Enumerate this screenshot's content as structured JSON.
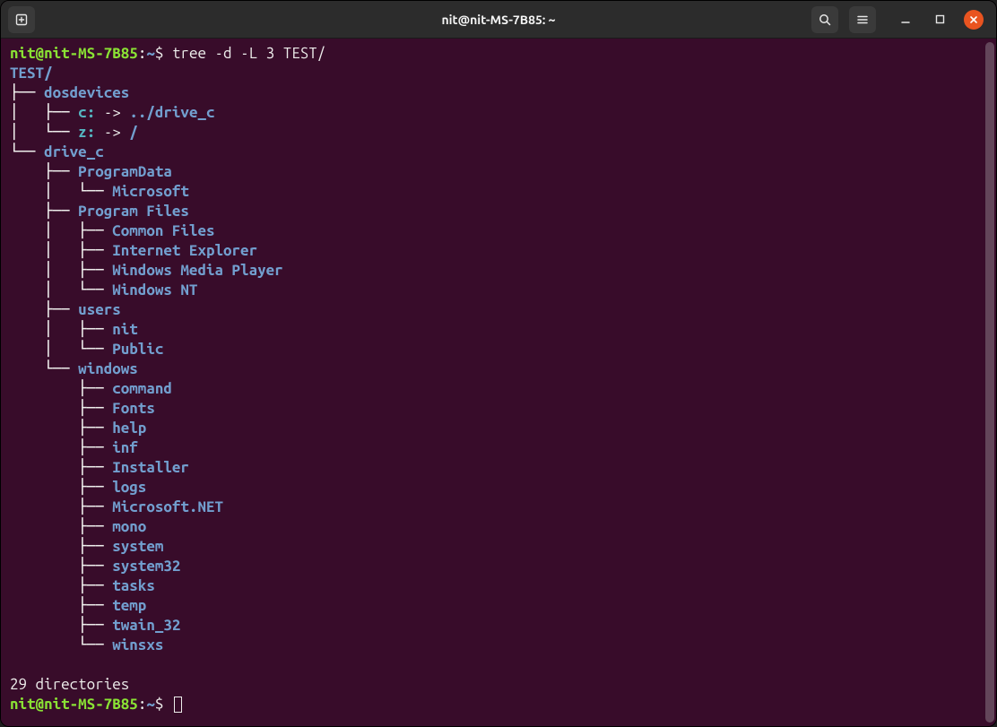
{
  "titlebar": {
    "title": "nit@nit-MS-7B85: ~"
  },
  "prompt": {
    "user_host": "nit@nit-MS-7B85",
    "separator": ":",
    "cwd": "~",
    "symbol": "$"
  },
  "command": "tree -d -L 3 TEST/",
  "tree_root": "TEST/",
  "tree_lines": [
    {
      "prefix": "├── ",
      "name": "dosdevices",
      "link": ""
    },
    {
      "prefix": "│   ├── ",
      "name": "c:",
      "link": " -> ../drive_c"
    },
    {
      "prefix": "│   └── ",
      "name": "z:",
      "link": " -> /"
    },
    {
      "prefix": "└── ",
      "name": "drive_c",
      "link": ""
    },
    {
      "prefix": "    ├── ",
      "name": "ProgramData",
      "link": ""
    },
    {
      "prefix": "    │   └── ",
      "name": "Microsoft",
      "link": ""
    },
    {
      "prefix": "    ├── ",
      "name": "Program Files",
      "link": ""
    },
    {
      "prefix": "    │   ├── ",
      "name": "Common Files",
      "link": ""
    },
    {
      "prefix": "    │   ├── ",
      "name": "Internet Explorer",
      "link": ""
    },
    {
      "prefix": "    │   ├── ",
      "name": "Windows Media Player",
      "link": ""
    },
    {
      "prefix": "    │   └── ",
      "name": "Windows NT",
      "link": ""
    },
    {
      "prefix": "    ├── ",
      "name": "users",
      "link": ""
    },
    {
      "prefix": "    │   ├── ",
      "name": "nit",
      "link": ""
    },
    {
      "prefix": "    │   └── ",
      "name": "Public",
      "link": ""
    },
    {
      "prefix": "    └── ",
      "name": "windows",
      "link": ""
    },
    {
      "prefix": "        ├── ",
      "name": "command",
      "link": ""
    },
    {
      "prefix": "        ├── ",
      "name": "Fonts",
      "link": ""
    },
    {
      "prefix": "        ├── ",
      "name": "help",
      "link": ""
    },
    {
      "prefix": "        ├── ",
      "name": "inf",
      "link": ""
    },
    {
      "prefix": "        ├── ",
      "name": "Installer",
      "link": ""
    },
    {
      "prefix": "        ├── ",
      "name": "logs",
      "link": ""
    },
    {
      "prefix": "        ├── ",
      "name": "Microsoft.NET",
      "link": ""
    },
    {
      "prefix": "        ├── ",
      "name": "mono",
      "link": ""
    },
    {
      "prefix": "        ├── ",
      "name": "system",
      "link": ""
    },
    {
      "prefix": "        ├── ",
      "name": "system32",
      "link": ""
    },
    {
      "prefix": "        ├── ",
      "name": "tasks",
      "link": ""
    },
    {
      "prefix": "        ├── ",
      "name": "temp",
      "link": ""
    },
    {
      "prefix": "        ├── ",
      "name": "twain_32",
      "link": ""
    },
    {
      "prefix": "        └── ",
      "name": "winsxs",
      "link": ""
    }
  ],
  "summary": "29 directories"
}
